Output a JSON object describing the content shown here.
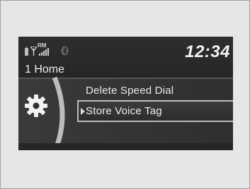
{
  "status": {
    "roaming_label": "RM",
    "time": "12:34"
  },
  "screen": {
    "title": "1 Home"
  },
  "menu": {
    "items": [
      {
        "label": "Delete Speed Dial",
        "selected": false
      },
      {
        "label": "Store Voice Tag",
        "selected": true
      }
    ]
  },
  "icons": {
    "battery": "battery-icon",
    "signal": "signal-strength-icon",
    "bluetooth": "bluetooth-icon",
    "settings": "gear-icon",
    "selector": "selector-arrow-icon"
  },
  "colors": {
    "screen_bg": "#2a2a2a",
    "text": "#eeeeee",
    "selection_border": "#bdbdbd"
  }
}
